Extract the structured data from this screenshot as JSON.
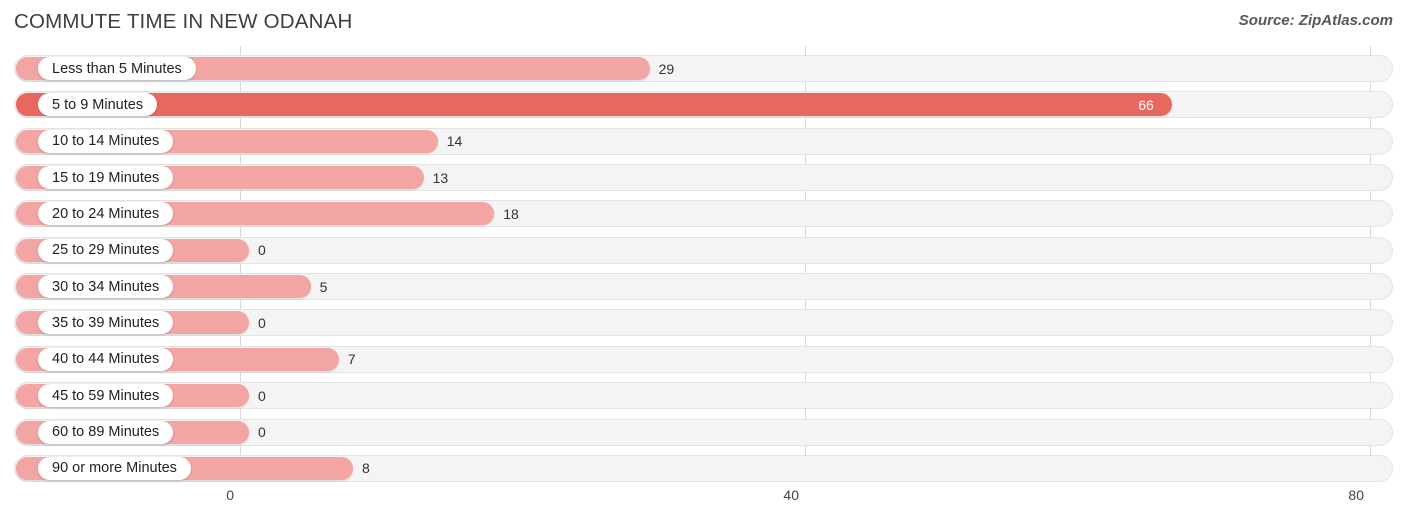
{
  "header": {
    "title": "COMMUTE TIME IN NEW ODANAH",
    "source": "Source: ZipAtlas.com"
  },
  "colors": {
    "bar_normal": "#f2a5a2",
    "bar_highlight": "#e8685f",
    "track_bg": "#f4f4f4",
    "track_border": "#e3e3e3",
    "gridline": "#d8d8d8",
    "title_text": "#3c4043",
    "source_text": "#58585b",
    "value_text": "#333333",
    "value_text_inside": "#ffffff",
    "label_text": "#222222",
    "label_pill_bg": "#ffffff"
  },
  "chart_data": {
    "type": "bar",
    "orientation": "horizontal",
    "title": "COMMUTE TIME IN NEW ODANAH",
    "subtitle": "",
    "xlabel": "",
    "ylabel": "",
    "xlim": [
      0,
      80
    ],
    "ticks": [
      0,
      40,
      80
    ],
    "tick_labels": [
      "0",
      "40",
      "80"
    ],
    "grid": true,
    "legend": false,
    "categories": [
      "Less than 5 Minutes",
      "5 to 9 Minutes",
      "10 to 14 Minutes",
      "15 to 19 Minutes",
      "20 to 24 Minutes",
      "25 to 29 Minutes",
      "30 to 34 Minutes",
      "35 to 39 Minutes",
      "40 to 44 Minutes",
      "45 to 59 Minutes",
      "60 to 89 Minutes",
      "90 or more Minutes"
    ],
    "values": [
      29,
      66,
      14,
      13,
      18,
      0,
      5,
      0,
      7,
      0,
      0,
      8
    ],
    "value_labels": [
      "29",
      "66",
      "14",
      "13",
      "18",
      "0",
      "5",
      "0",
      "7",
      "0",
      "0",
      "8"
    ],
    "highlight_index": 1
  }
}
